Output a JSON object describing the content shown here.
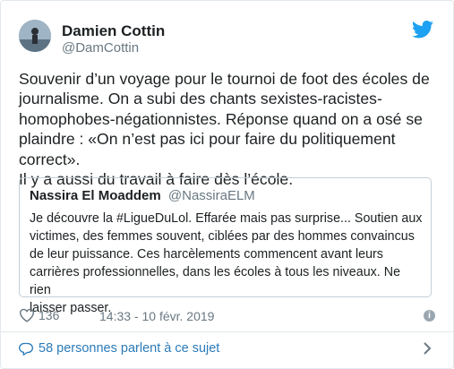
{
  "author": {
    "name": "Damien Cottin",
    "handle": "@DamCottin"
  },
  "tweet": {
    "text": "Souvenir d’un voyage pour le tournoi de foot des écoles de\njournalisme. On a subi des chants sexistes-racistes-\nhomophobes-négationnistes. Réponse quand on a osé se\nplaindre : «On n’est pas ici pour faire du politiquement correct».\nIl y a aussi du travail à faire dès l’école."
  },
  "quoted": {
    "name": "Nassira El Moaddem",
    "handle": "@NassiraELM",
    "text": "Je découvre la #LigueDuLol. Effarée mais pas surprise... Soutien aux\nvictimes, des femmes souvent, ciblées par des hommes convaincus\nde leur puissance. Ces harcèlements commencent avant leurs\ncarrières professionnelles, dans les écoles à tous les niveaux. Ne rien\nlaisser passer."
  },
  "meta": {
    "likes": "136",
    "timestamp": "14:33 - 10 févr. 2019",
    "info_glyph": "i"
  },
  "footer": {
    "talking": "58 personnes parlent à ce sujet"
  },
  "colors": {
    "twitter_blue": "#1da1f2",
    "link_blue": "#2b7bb9",
    "secondary_text": "#697882"
  },
  "icons": {
    "brand": "twitter-bird-icon",
    "like": "heart-icon",
    "reply": "speech-bubble-icon",
    "more": "chevron-right-icon",
    "info": "info-icon"
  }
}
